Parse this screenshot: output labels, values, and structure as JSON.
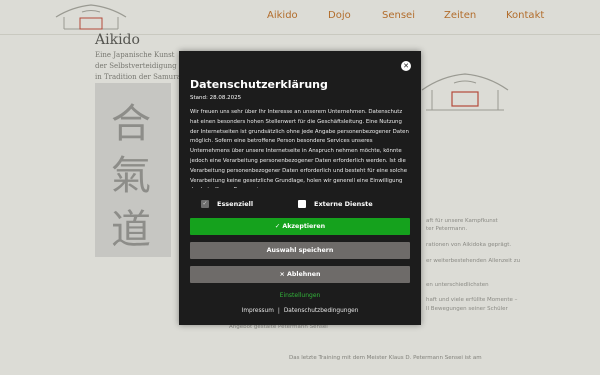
{
  "site": {
    "nav": [
      "Aikido",
      "Dojo",
      "Sensei",
      "Zeiten",
      "Kontakt"
    ],
    "title": "Aikido",
    "subtitle_lines": [
      "Eine Japanische Kunst",
      "der Selbstverteidigung",
      "in Tradition der Samurai"
    ],
    "calligraphy": [
      "合",
      "氣",
      "道"
    ],
    "faint_lines": [
      "aft für unsere Kampfkunst",
      "ter Petermann.",
      "rationen von Aikidoka geprägt.",
      "er weiterbestehenden Allenzeit zu",
      "en unterschiedlichsten",
      "haft und viele erfüllte Momente –",
      "ll Bewegungen seiner Schüler",
      "Angebot gestalte Petermann Sensei"
    ],
    "bottom_text": "Das letzte Training mit dem Meister Klaus D. Petermann Sensei ist am"
  },
  "consent": {
    "title": "Datenschutzerklärung",
    "stand": "Stand: 28.08.2025",
    "body": "Wir freuen uns sehr über Ihr Interesse an unserem Unternehmen. Datenschutz hat einen besonders hohen Stellenwert für die Geschäftsleitung. Eine Nutzung der Internetseiten ist grundsätzlich ohne jede Angabe personenbezogener Daten möglich. Sofern eine betroffene Person besondere Services unseres Unternehmens über unsere Internetseite in Anspruch nehmen möchte, könnte jedoch eine Verarbeitung personenbezogener Daten erforderlich werden. Ist die Verarbeitung personenbezogener Daten erforderlich und besteht für eine solche Verarbeitung keine gesetzliche Grundlage, holen wir generell eine Einwilligung der betroffenen Person ein.",
    "close_symbol": "✕",
    "checkbox_essential": "Essenziell",
    "checkbox_external": "Externe Dienste",
    "accept": "✓ Akzeptieren",
    "save": "Auswahl speichern",
    "reject": "× Ablehnen",
    "settings": "Einstellungen",
    "link_imprint": "Impressum",
    "link_separator": "|",
    "link_privacy": "Datenschutzbedingungen"
  },
  "colors": {
    "accent_green": "#15a21d",
    "nav_text": "#b26d2c",
    "dialog_bg": "#1c1c1c",
    "button_gray": "#6e6b69"
  },
  "icons": {
    "close": "close-icon",
    "check": "check-icon",
    "logo": "dojo-house-logo"
  }
}
